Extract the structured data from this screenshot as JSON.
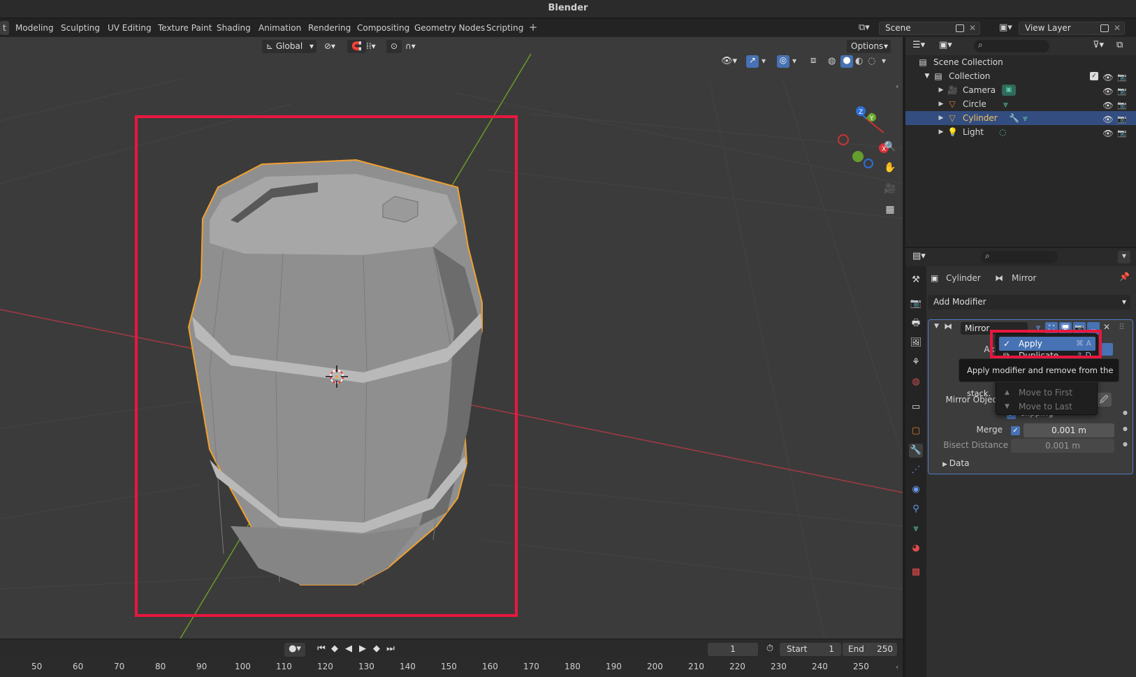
{
  "app": {
    "title": "Blender"
  },
  "workspace_tabs": [
    "t",
    "Modeling",
    "Sculpting",
    "UV Editing",
    "Texture Paint",
    "Shading",
    "Animation",
    "Rendering",
    "Compositing",
    "Geometry Nodes",
    "Scripting"
  ],
  "add_tab": "+",
  "scene": {
    "label": "Scene",
    "view_layer": "View Layer"
  },
  "viewport": {
    "transform_orientation": "Global",
    "options_label": "Options"
  },
  "outliner": {
    "root": "Scene Collection",
    "collection": "Collection",
    "items": [
      {
        "name": "Camera",
        "color": "#e07b2a"
      },
      {
        "name": "Circle",
        "color": "#e07b2a"
      },
      {
        "name": "Cylinder",
        "color": "#e8a33a",
        "selected": true
      },
      {
        "name": "Light",
        "color": "#e07b2a"
      }
    ]
  },
  "properties": {
    "object_name": "Cylinder",
    "modifier_crumb": "Mirror",
    "add_modifier": "Add Modifier",
    "modifier": {
      "name": "Mirror",
      "axis_label": "Axi",
      "mirror_object_label": "Mirror Objec",
      "clipping_label": "Clipping",
      "merge_label": "Merge",
      "merge_value": "0.001 m",
      "bisect_label": "Bisect Distance",
      "bisect_value": "0.001 m",
      "data_label": "Data"
    }
  },
  "context_menu": {
    "items": [
      {
        "label": "Apply",
        "shortcut": "⌘ A",
        "highlighted": true
      },
      {
        "label": "Duplicate",
        "shortcut": "⇧ D",
        "highlighted": false
      },
      {
        "label": "Move to First",
        "shortcut": "",
        "highlighted": false
      },
      {
        "label": "Move to Last",
        "shortcut": "",
        "highlighted": false
      }
    ],
    "tooltip": "Apply modifier and remove from the stack."
  },
  "timeline": {
    "current_frame": "1",
    "start_label": "Start",
    "start_value": "1",
    "end_label": "End",
    "end_value": "250",
    "ruler_ticks": [
      "50",
      "60",
      "70",
      "80",
      "90",
      "100",
      "110",
      "120",
      "130",
      "140",
      "150",
      "160",
      "170",
      "180",
      "190",
      "200",
      "210",
      "220",
      "230",
      "240",
      "250"
    ]
  },
  "colors": {
    "highlight_red": "#e8173f",
    "selection_blue": "#334d80",
    "accent_blue": "#4772b3"
  }
}
